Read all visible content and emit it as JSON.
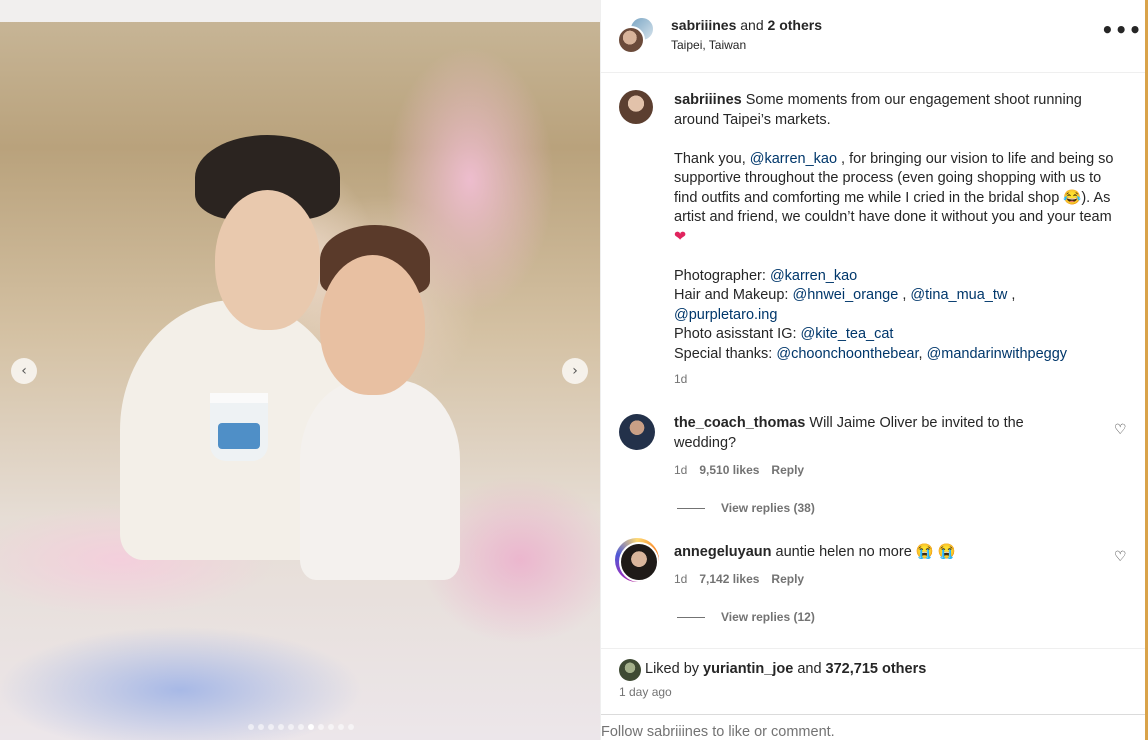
{
  "carousel": {
    "prev_icon": "‹",
    "next_icon": "›",
    "dot_count": 11,
    "active_dot": 6
  },
  "header": {
    "username": "sabriiines",
    "connector": " and ",
    "others": "2 others",
    "location": "Taipei, Taiwan",
    "more_icon": "•••"
  },
  "caption": {
    "username": "sabriiines",
    "intro": " Some moments from our engagement shoot running around Taipei’s markets.",
    "thanks_pre": "Thank you, ",
    "thanks_mention": "@karren_kao",
    "thanks_post": " , for bringing our vision to life and being so supportive throughout the process (even going shopping with us to find outfits and comforting me while I cried in the bridal shop 😂). As artist and friend, we couldn’t have done it without you and your team ",
    "heart": "❤",
    "photographer_label": "Photographer: ",
    "photographer": "@karren_kao",
    "hair_label": "Hair and Makeup: ",
    "hair1": "@hnwei_orange",
    "hair2": "@tina_mua_tw",
    "hair3": "@purpletaro.ing",
    "assistant_label": "Photo asisstant IG: ",
    "assistant": "@kite_tea_cat",
    "thanks2_label": "Special thanks: ",
    "thanks2_1": "@choonchoonthebear",
    "thanks2_2": "@mandarinwithpeggy",
    "time": "1d"
  },
  "comments": [
    {
      "username": "the_coach_thomas",
      "text": " Will Jaime Oliver be invited to the wedding?",
      "time": "1d",
      "likes": "9,510 likes",
      "reply": "Reply",
      "view_replies": "View replies (38)"
    },
    {
      "username": "annegeluyaun",
      "text": " auntie helen no more 😭 😭",
      "time": "1d",
      "likes": "7,142 likes",
      "reply": "Reply",
      "view_replies": "View replies (12)"
    }
  ],
  "footer": {
    "liked_pre": "Liked by ",
    "liked_user": "yuriantin_joe",
    "liked_mid": " and ",
    "liked_count": "372,715 others",
    "time": "1 day ago",
    "follow_prompt": "Follow sabriiines to like or comment."
  }
}
